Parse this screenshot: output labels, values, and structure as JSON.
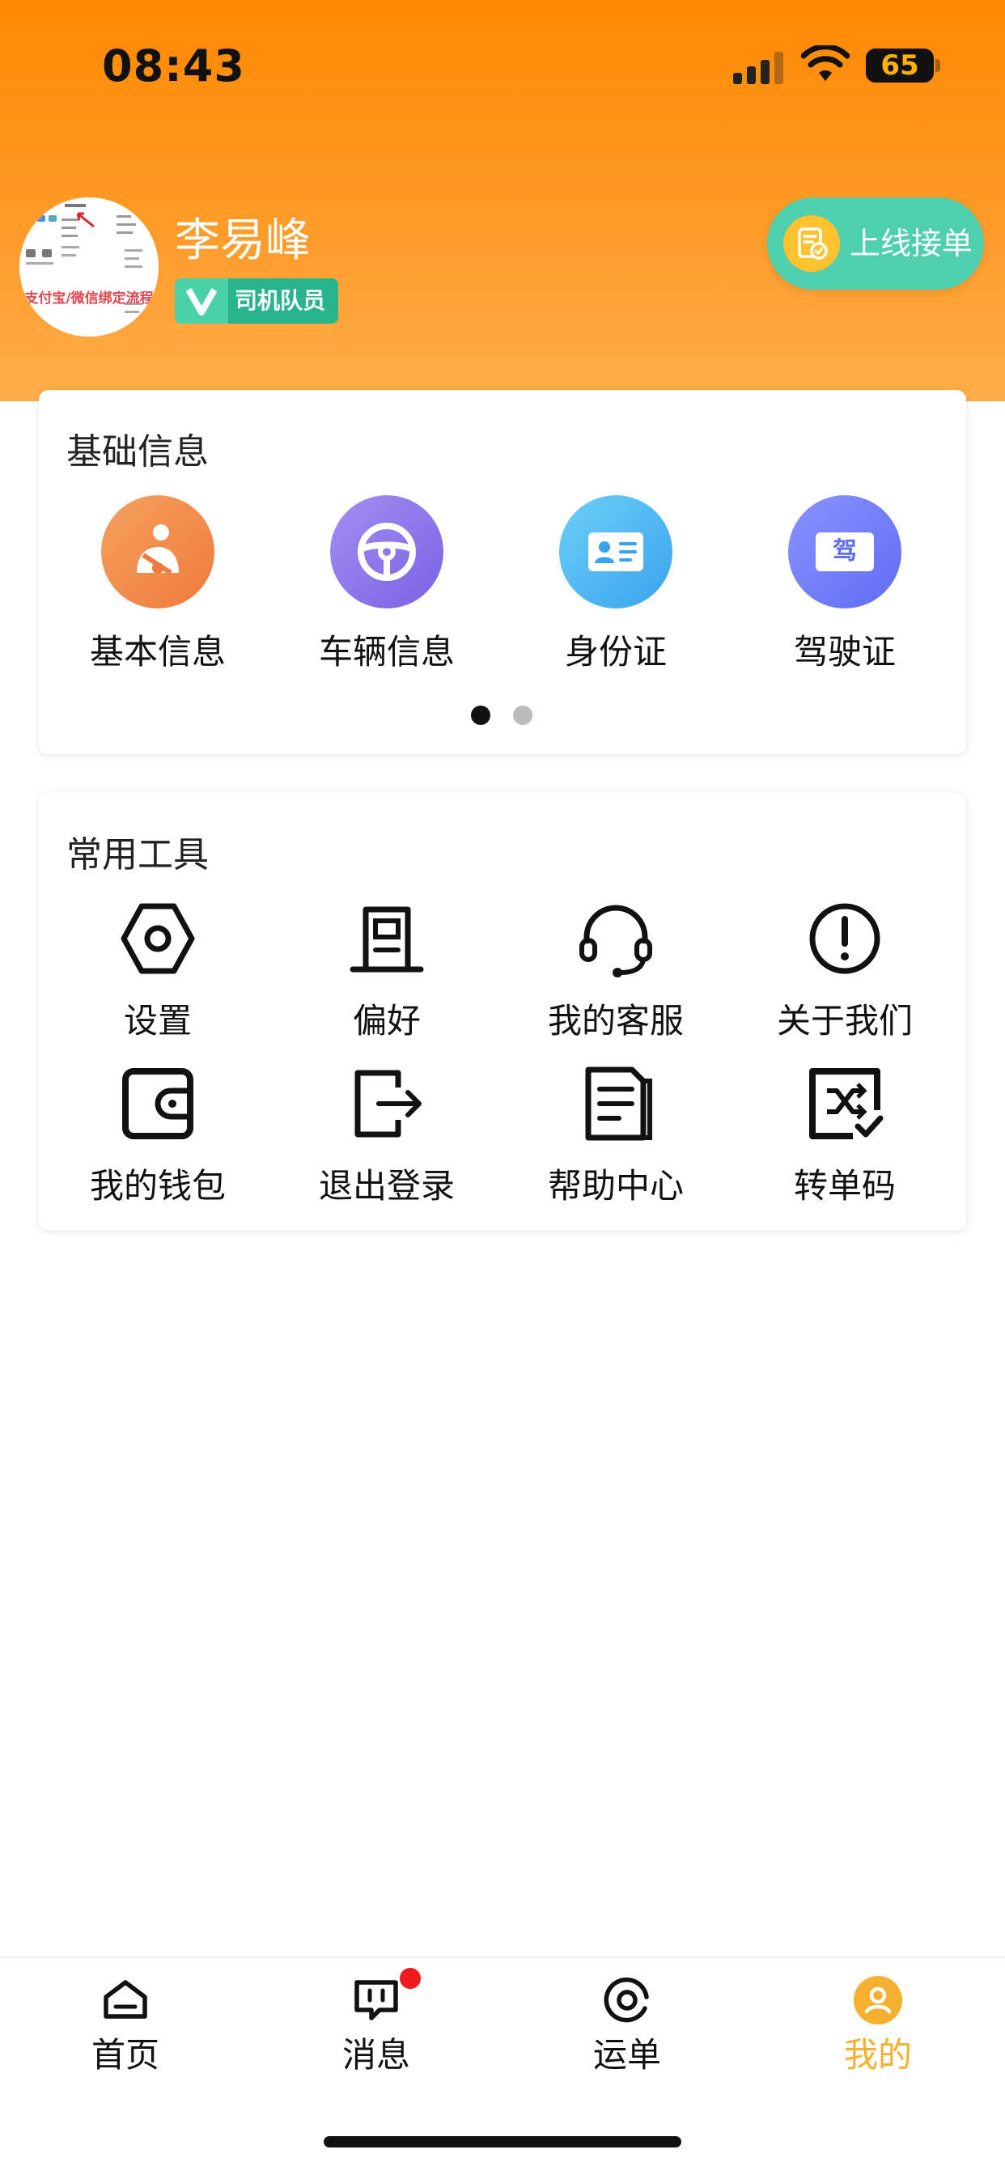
{
  "status_bar": {
    "time": "08:43",
    "battery": "65"
  },
  "profile": {
    "name": "李易峰",
    "role_badge": "司机队员",
    "avatar_caption": "支付宝/微信绑定流程"
  },
  "online_button": {
    "label": "上线接单"
  },
  "basic_info": {
    "title": "基础信息",
    "items": [
      {
        "label": "基本信息",
        "icon": "seatbelt-person-icon",
        "color_from": "#f6a160",
        "color_to": "#ee7a3c"
      },
      {
        "label": "车辆信息",
        "icon": "steering-wheel-icon",
        "color_from": "#a38ef2",
        "color_to": "#7a62e3"
      },
      {
        "label": "身份证",
        "icon": "id-card-icon",
        "color_from": "#6dd0f7",
        "color_to": "#3aa2ee"
      },
      {
        "label": "驾驶证",
        "icon": "driver-license-icon",
        "color_from": "#8a93ff",
        "color_to": "#5f6cf3"
      }
    ],
    "license_icon_char": "驾",
    "pager": {
      "active_color": "#111111",
      "inactive_color": "#bbbbbb"
    }
  },
  "tools": {
    "title": "常用工具",
    "items": [
      {
        "label": "设置",
        "icon": "settings-hexagon-icon"
      },
      {
        "label": "偏好",
        "icon": "preference-icon"
      },
      {
        "label": "我的客服",
        "icon": "headset-icon"
      },
      {
        "label": "关于我们",
        "icon": "info-alert-icon"
      },
      {
        "label": "我的钱包",
        "icon": "wallet-icon"
      },
      {
        "label": "退出登录",
        "icon": "logout-icon"
      },
      {
        "label": "帮助中心",
        "icon": "help-document-icon"
      },
      {
        "label": "转单码",
        "icon": "transfer-code-icon"
      }
    ]
  },
  "bottom_nav": {
    "items": [
      {
        "label": "首页",
        "icon": "home-icon",
        "active": false
      },
      {
        "label": "消息",
        "icon": "message-icon",
        "active": false,
        "badge": true
      },
      {
        "label": "运单",
        "icon": "waybill-icon",
        "active": false
      },
      {
        "label": "我的",
        "icon": "profile-icon",
        "active": true
      }
    ],
    "active_color": "#f5b030"
  },
  "colors": {
    "header_orange": "#ff8800",
    "online_green": "#4ecfae",
    "badge_green": "#29b48e",
    "badge_red": "#ee1c1c"
  }
}
